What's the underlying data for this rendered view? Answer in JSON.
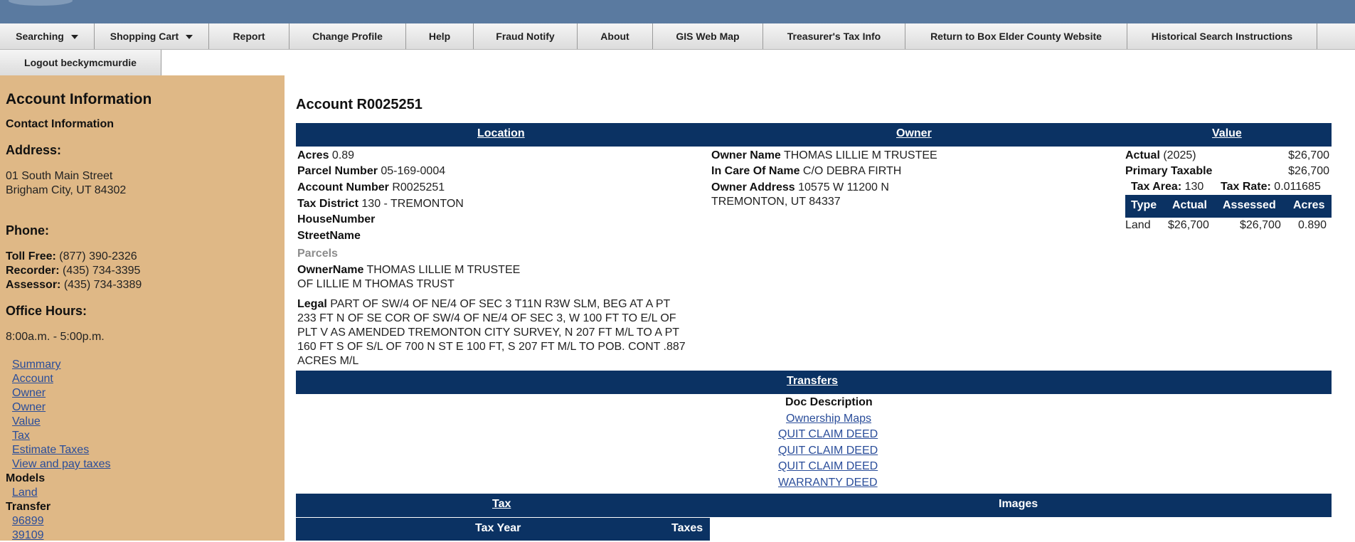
{
  "menu": {
    "searching": "Searching",
    "shopping_cart": "Shopping Cart",
    "report": "Report",
    "change_profile": "Change Profile",
    "help": "Help",
    "fraud_notify": "Fraud Notify",
    "about": "About",
    "gis_web_map": "GIS Web Map",
    "treasurers_tax_info": "Treasurer's Tax Info",
    "return_website": "Return to Box Elder County Website",
    "historical_search": "Historical Search Instructions",
    "logout": "Logout beckymcmurdie"
  },
  "sidebar": {
    "heading": "Account Information",
    "contact": "Contact Information",
    "address_label": "Address:",
    "address_line1": "01 South Main Street",
    "address_line2": "Brigham City, UT 84302",
    "phone_label": "Phone:",
    "toll_free_label": "Toll Free:",
    "toll_free": " (877) 390-2326",
    "recorder_label": "Recorder:",
    "recorder": " (435) 734-3395",
    "assessor_label": "Assessor:",
    "assessor": " (435) 734-3389",
    "office_hours_label": "Office Hours:",
    "office_hours": "8:00a.m. - 5:00p.m.",
    "links": [
      "Summary",
      "Account",
      "Owner",
      "Owner",
      "Value",
      "Tax",
      "Estimate Taxes",
      "View and pay taxes"
    ],
    "models_label": "Models",
    "models_links": [
      "Land"
    ],
    "transfer_label": "Transfer",
    "transfer_links": [
      "96899",
      "39109"
    ]
  },
  "account": {
    "title": "Account  R0025251"
  },
  "sections": {
    "location": "Location",
    "owner": "Owner",
    "value": "Value",
    "transfers": "Transfers",
    "tax": "Tax",
    "images": "Images"
  },
  "location": {
    "acres_label": "Acres",
    "acres": " 0.89",
    "parcel_label": "Parcel Number",
    "parcel": " 05-169-0004",
    "account_label": "Account Number",
    "account": " R0025251",
    "district_label": "Tax District",
    "district": " 130 - TREMONTON",
    "house_label": "HouseNumber",
    "street_label": "StreetName",
    "parcels_label": "Parcels",
    "ownername_label": "OwnerName",
    "ownername_line1": " THOMAS LILLIE M TRUSTEE",
    "ownername_line2": "OF LILLIE M THOMAS TRUST",
    "legal_label": "Legal",
    "legal_line1": " PART OF SW/4 OF NE/4 OF SEC 3 T11N R3W SLM, BEG AT A PT",
    "legal_line2": "233 FT N OF SE COR OF SW/4 OF NE/4 OF SEC 3, W 100 FT TO E/L OF",
    "legal_line3": "PLT V AS AMENDED TREMONTON CITY SURVEY, N 207 FT M/L TO A PT",
    "legal_line4": "160 FT S OF S/L OF 700 N ST E 100 FT, S 207 FT M/L TO POB. CONT .887",
    "legal_line5": "ACRES M/L"
  },
  "owner": {
    "name_label": "Owner Name",
    "name": " THOMAS LILLIE M TRUSTEE",
    "care_label": "In Care Of Name",
    "care": " C/O DEBRA FIRTH",
    "address_label": "Owner Address",
    "address_line1": " 10575 W 11200 N",
    "address_line2": "TREMONTON, UT 84337"
  },
  "value": {
    "actual_label": "Actual",
    "actual_year": " (2025)",
    "actual_amount": "$26,700",
    "primary_label": "Primary Taxable",
    "primary_amount": "$26,700",
    "tax_area_label": "Tax Area:",
    "tax_area": " 130",
    "tax_rate_label": "Tax Rate:",
    "tax_rate": " 0.011685",
    "table_headers": [
      "Type",
      "Actual",
      "Assessed",
      "Acres"
    ],
    "table_row": [
      "Land",
      "$26,700",
      "$26,700",
      "0.890"
    ]
  },
  "transfers": {
    "doc_header": "Doc Description",
    "items": [
      "Ownership Maps",
      "QUIT CLAIM DEED",
      "QUIT CLAIM DEED",
      "QUIT CLAIM DEED",
      "WARRANTY DEED"
    ]
  },
  "tax": {
    "headers": [
      "Tax Year",
      "Taxes"
    ]
  }
}
